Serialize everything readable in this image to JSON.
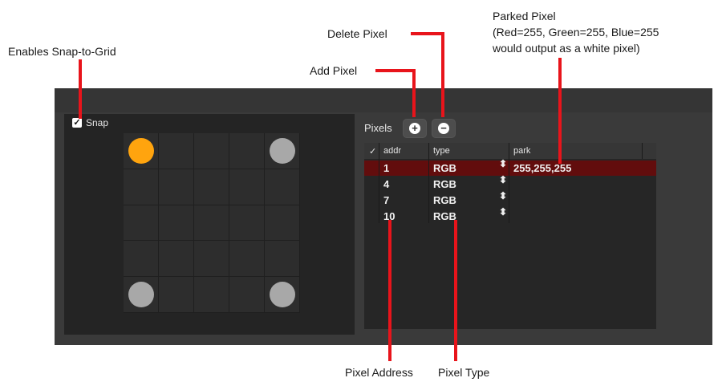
{
  "callouts": {
    "snap": "Enables Snap-to-Grid",
    "add_pixel": "Add Pixel",
    "delete_pixel": "Delete Pixel",
    "parked_line1": "Parked Pixel",
    "parked_line2": "(Red=255, Green=255, Blue=255",
    "parked_line3": "would output as a white pixel)",
    "pixel_address": "Pixel Address",
    "pixel_type": "Pixel Type"
  },
  "snap": {
    "label": "Snap",
    "checked": true,
    "check_glyph": "✓"
  },
  "pixels": {
    "label": "Pixels",
    "add_icon": "plus-circle-icon",
    "add_glyph": "+",
    "remove_icon": "minus-circle-icon",
    "remove_glyph": "−"
  },
  "table": {
    "columns": [
      "✓",
      "addr",
      "type",
      "park"
    ],
    "rows": [
      {
        "addr": "1",
        "type": "RGB",
        "arrows": "⬍",
        "park": "255,255,255",
        "selected": true
      },
      {
        "addr": "4",
        "type": "RGB",
        "arrows": "⬍",
        "park": "",
        "selected": false
      },
      {
        "addr": "7",
        "type": "RGB",
        "arrows": "⬍",
        "park": "",
        "selected": false
      },
      {
        "addr": "10",
        "type": "RGB",
        "arrows": "⬍",
        "park": "",
        "selected": false
      }
    ]
  },
  "grid": {
    "cols": 5,
    "rows": 5,
    "dots": [
      {
        "row": 0,
        "col": 0,
        "color": "#ffa40e"
      },
      {
        "row": 0,
        "col": 4,
        "color": "#a8a8a8"
      },
      {
        "row": 4,
        "col": 0,
        "color": "#a8a8a8"
      },
      {
        "row": 4,
        "col": 4,
        "color": "#a8a8a8"
      }
    ]
  },
  "colors": {
    "callout_line": "#e8141b",
    "selected_row": "#620d0d",
    "active_pixel": "#ffa40e"
  }
}
